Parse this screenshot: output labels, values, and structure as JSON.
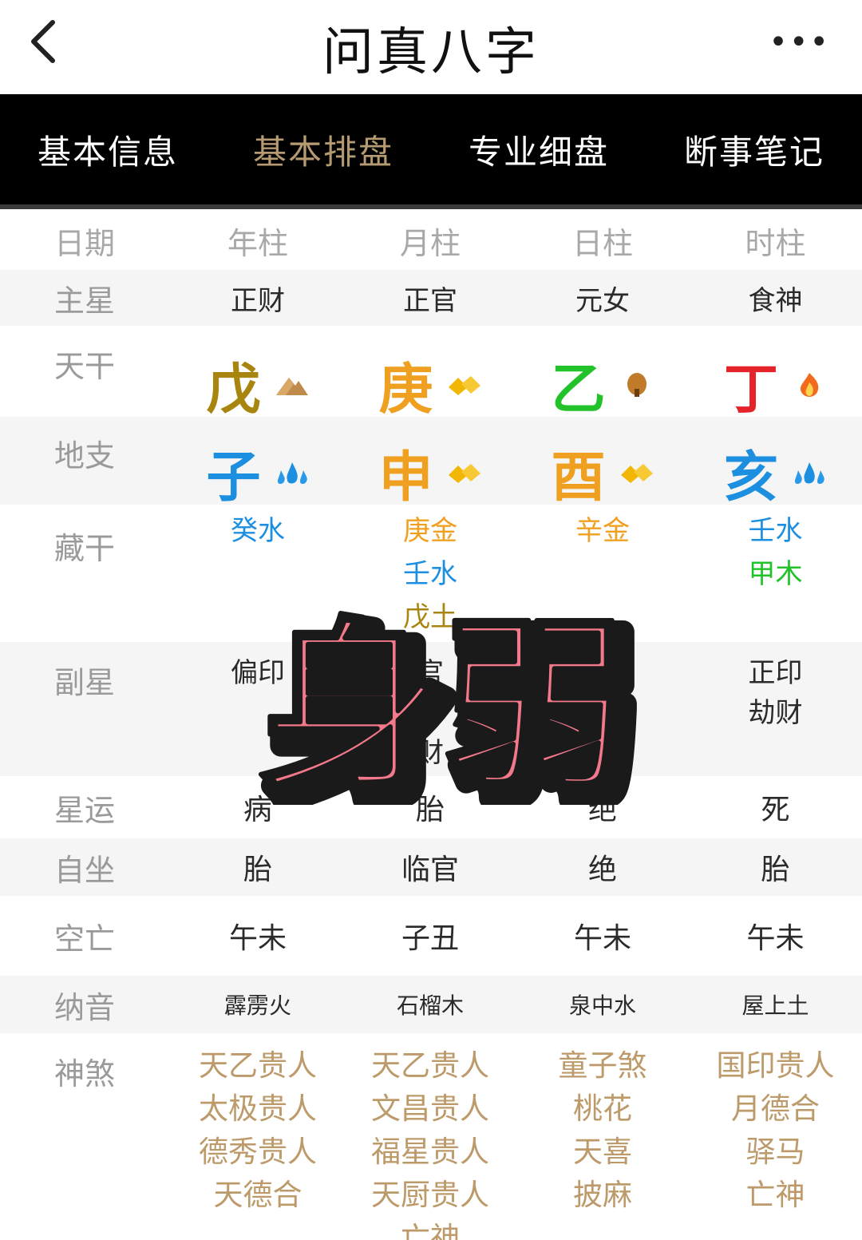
{
  "header": {
    "title": "问真八字",
    "back_icon": "back-chevron-icon",
    "more_icon": "more-dots-icon"
  },
  "tabs": [
    {
      "label": "基本信息",
      "active": false
    },
    {
      "label": "基本排盘",
      "active": true
    },
    {
      "label": "专业细盘",
      "active": false
    },
    {
      "label": "断事笔记",
      "active": false
    }
  ],
  "columns": {
    "label": "日期",
    "pillars": [
      "年柱",
      "月柱",
      "日柱",
      "时柱"
    ]
  },
  "rows": {
    "main_star": {
      "label": "主星",
      "values": [
        "正财",
        "正官",
        "元女",
        "食神"
      ]
    },
    "tiangan": {
      "label": "天干",
      "values": [
        {
          "char": "戊",
          "color": "#a8850f",
          "icon": "earth-mountain-icon"
        },
        {
          "char": "庚",
          "color": "#f0a020",
          "icon": "metal-gold-icon"
        },
        {
          "char": "乙",
          "color": "#22c32a",
          "icon": "wood-tree-icon"
        },
        {
          "char": "丁",
          "color": "#e5232a",
          "icon": "fire-flame-icon"
        }
      ]
    },
    "dizhi": {
      "label": "地支",
      "values": [
        {
          "char": "子",
          "color": "#1d8fe0",
          "icon": "water-drops-icon"
        },
        {
          "char": "申",
          "color": "#f0a020",
          "icon": "metal-gold-icon"
        },
        {
          "char": "酉",
          "color": "#f0a020",
          "icon": "metal-gold-icon"
        },
        {
          "char": "亥",
          "color": "#1d8fe0",
          "icon": "water-drops-icon"
        }
      ]
    },
    "canggan": {
      "label": "藏干",
      "values": [
        [
          {
            "text": "癸水",
            "color": "#1d8fe0"
          }
        ],
        [
          {
            "text": "庚金",
            "color": "#f0a020"
          },
          {
            "text": "壬水",
            "color": "#1d8fe0"
          },
          {
            "text": "戊土",
            "color": "#a8850f"
          }
        ],
        [
          {
            "text": "辛金",
            "color": "#f0a020"
          }
        ],
        [
          {
            "text": "壬水",
            "color": "#1d8fe0"
          },
          {
            "text": "甲木",
            "color": "#22c32a"
          }
        ]
      ]
    },
    "fuxing": {
      "label": "副星",
      "values": [
        [
          "偏印"
        ],
        [
          "官",
          "才",
          "财"
        ],
        [],
        [
          "正印",
          "劫财"
        ]
      ]
    },
    "xingyun": {
      "label": "星运",
      "values": [
        "病",
        "胎",
        "绝",
        "死"
      ]
    },
    "zizuo": {
      "label": "自坐",
      "values": [
        "胎",
        "临官",
        "绝",
        "胎"
      ]
    },
    "kongwang": {
      "label": "空亡",
      "values": [
        "午未",
        "子丑",
        "午未",
        "午未"
      ]
    },
    "nayin": {
      "label": "纳音",
      "values": [
        "霹雳火",
        "石榴木",
        "泉中水",
        "屋上土"
      ]
    },
    "shensha": {
      "label": "神煞",
      "values": [
        [
          "天乙贵人",
          "太极贵人",
          "德秀贵人",
          "天德合"
        ],
        [
          "天乙贵人",
          "文昌贵人",
          "福星贵人",
          "天厨贵人",
          "亡神"
        ],
        [
          "童子煞",
          "桃花",
          "天喜",
          "披麻"
        ],
        [
          "国印贵人",
          "月德合",
          "驿马",
          "亡神"
        ]
      ]
    }
  },
  "overlay": {
    "text": "身弱",
    "fill": "#f2788a",
    "shadow": "#1a1a1a"
  }
}
